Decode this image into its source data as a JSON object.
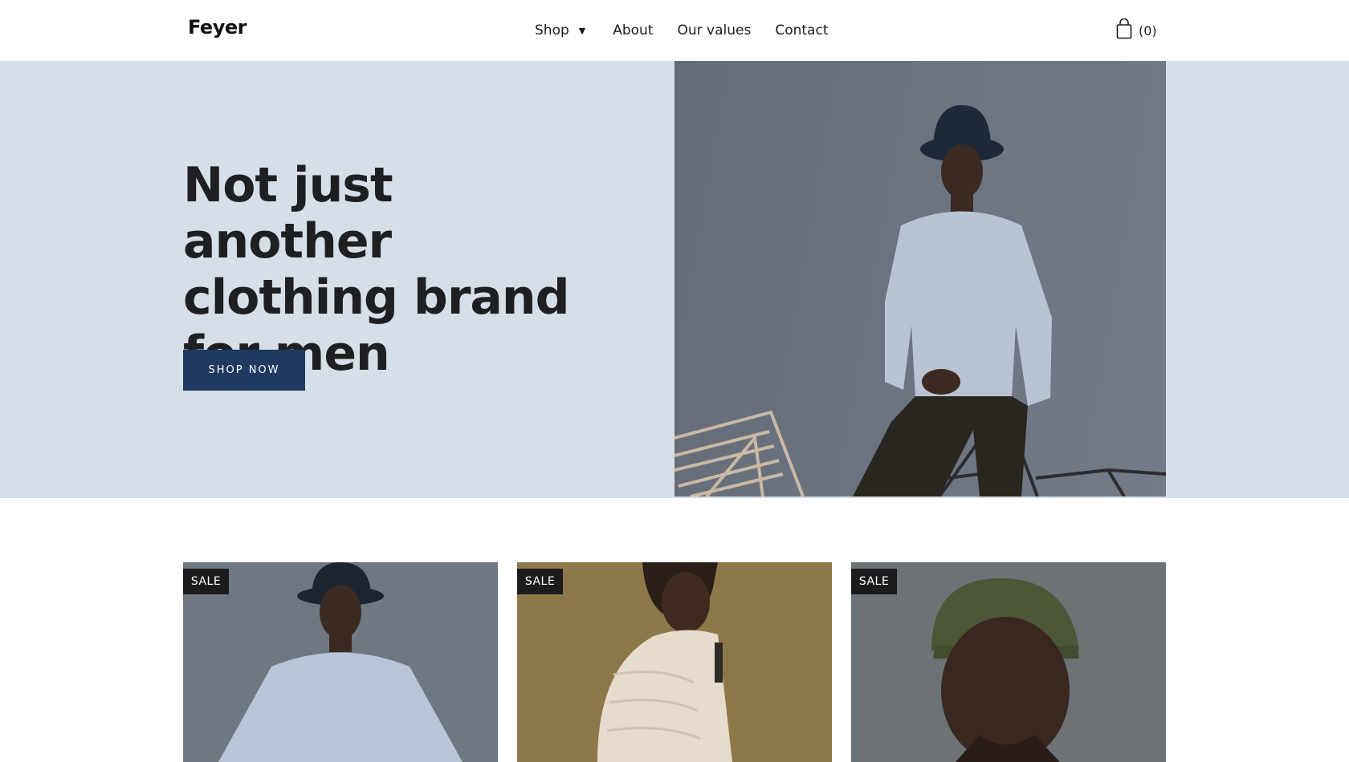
{
  "header": {
    "logo": "Feyer",
    "nav": {
      "shop": "Shop",
      "about": "About",
      "values": "Our values",
      "contact": "Contact"
    },
    "cart_count": "(0)"
  },
  "hero": {
    "title_line1": "Not just another",
    "title_line2": "clothing brand",
    "title_line3": "for men",
    "cta": "SHOP NOW"
  },
  "products": [
    {
      "badge": "SALE"
    },
    {
      "badge": "SALE"
    },
    {
      "badge": "SALE"
    }
  ],
  "colors": {
    "hero_bg": "#d6dee7",
    "cta_bg": "#1f3a60",
    "badge_bg": "#1c1c1e"
  }
}
